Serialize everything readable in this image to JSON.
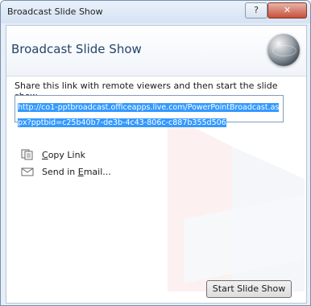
{
  "window": {
    "title": "Broadcast Slide Show",
    "help_label": "?",
    "close_label": "✕"
  },
  "banner": {
    "title": "Broadcast Slide Show"
  },
  "main": {
    "instruction": "Share this link with remote viewers and then start the slide show.",
    "link": "http://co1-pptbroadcast.officeapps.live.com/PowerPointBroadcast.aspx?pptbid=c25b40b7-de3b-4c43-806c-c887b355d506",
    "actions": [
      {
        "label": "Copy Link",
        "accesskey": "C",
        "icon": "copy-icon"
      },
      {
        "label": "Send in Email...",
        "accesskey": "E",
        "icon": "email-icon"
      }
    ]
  },
  "footer": {
    "start_label": "Start Slide Show"
  },
  "colors": {
    "selection": "#3399ff",
    "banner_title": "#23456b"
  }
}
